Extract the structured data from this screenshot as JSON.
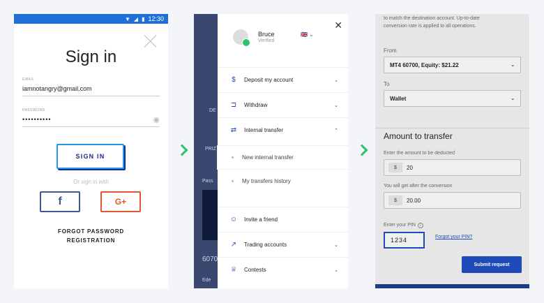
{
  "screen1": {
    "status_time": "12:30",
    "title": "Sign in",
    "email_label": "EMAIL",
    "email_value": "iamnotangry@gmail.com",
    "password_label": "PASSWORD",
    "password_value": "••••••••••",
    "signin_button": "SIGN IN",
    "or_text": "Or sign in with",
    "facebook_glyph": "f",
    "google_glyph": "G+",
    "forgot_password": "FORGOT PASSWORD",
    "registration": "REGISTRATION"
  },
  "screen2": {
    "user_name": "Bruce",
    "user_status": "Verified",
    "flag": "🇬🇧 ⌄",
    "bg_texts": [
      "DE",
      "PRIZ",
      "Pass",
      "6070",
      "Ede"
    ],
    "menu": [
      {
        "label": "Deposit my account",
        "icon": "$"
      },
      {
        "label": "Withdraw",
        "icon": "⊐"
      },
      {
        "label": "Internal transfer",
        "icon": "⇄"
      }
    ],
    "sub_items": [
      "New internal transfer",
      "My transfers history"
    ],
    "menu_bottom": [
      {
        "label": "Invite a friend",
        "icon": "☺"
      },
      {
        "label": "Trading accounts",
        "icon": "↗"
      },
      {
        "label": "Contests",
        "icon": "♕"
      }
    ]
  },
  "screen3": {
    "intro_line1": "to match the destination account. Up-to-date",
    "intro_line2": "conversion rate is applied to all operations.",
    "from_label": "From",
    "from_value": "MT4 60700, Equity: $21.22",
    "to_label": "To",
    "to_value": "Wallet",
    "heading": "Amount to transfer",
    "deduct_label": "Enter the amount to be deducted",
    "deduct_value": "20",
    "convert_label": "You will get after the conversion",
    "convert_value": "20.00",
    "currency": "$",
    "pin_label": "Enter your PIN",
    "pin_value": "1234",
    "forgot_pin": "Forgot your PIN?",
    "submit": "Submit request"
  }
}
